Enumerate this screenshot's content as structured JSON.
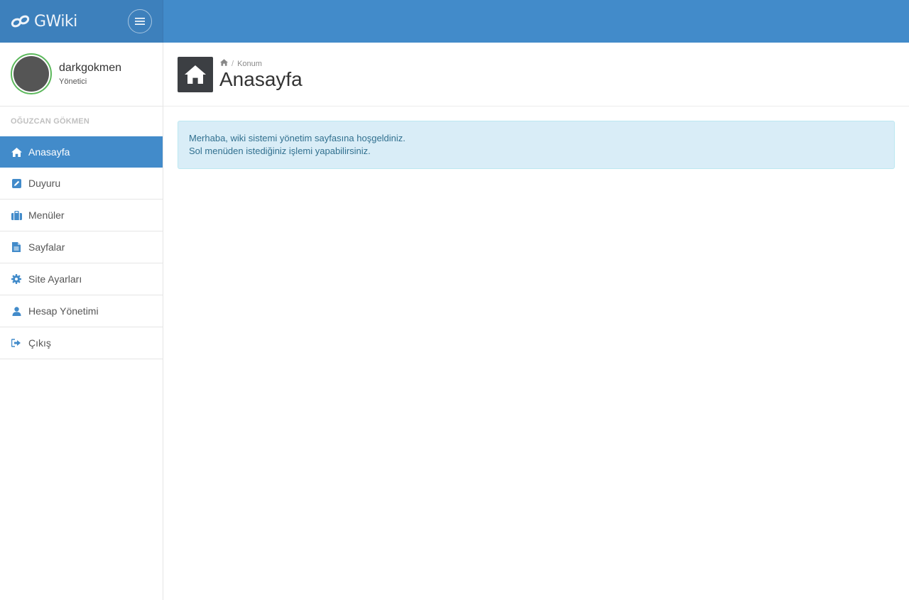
{
  "brand": {
    "name": "GWiki",
    "icon": "chain-link-icon"
  },
  "header": {
    "menu_toggle_icon": "hamburger-icon"
  },
  "profile": {
    "username": "darkgokmen",
    "role": "Yönetici",
    "status_color": "#5cb85c"
  },
  "sidebar": {
    "section_title": "OĞUZCAN GÖKMEN",
    "items": [
      {
        "label": "Anasayfa",
        "icon": "home-icon",
        "active": true
      },
      {
        "label": "Duyuru",
        "icon": "edit-icon"
      },
      {
        "label": "Menüler",
        "icon": "briefcase-icon"
      },
      {
        "label": "Sayfalar",
        "icon": "file-icon"
      },
      {
        "label": "Site Ayarları",
        "icon": "gear-icon"
      },
      {
        "label": "Hesap Yönetimi",
        "icon": "user-icon"
      },
      {
        "label": "Çıkış",
        "icon": "sign-out-icon"
      }
    ]
  },
  "page": {
    "breadcrumb": {
      "home_icon": "home-icon",
      "current": "Konum"
    },
    "title": "Anasayfa",
    "header_icon": "home-icon"
  },
  "alert": {
    "line1": "Merhaba, wiki sistemi yönetim sayfasına hoşgeldiniz.",
    "line2": "Sol menüden istediğiniz işlemi yapabilirsiniz."
  },
  "colors": {
    "primary": "#428bca",
    "alert_bg": "#d9edf7",
    "alert_text": "#31708f"
  }
}
